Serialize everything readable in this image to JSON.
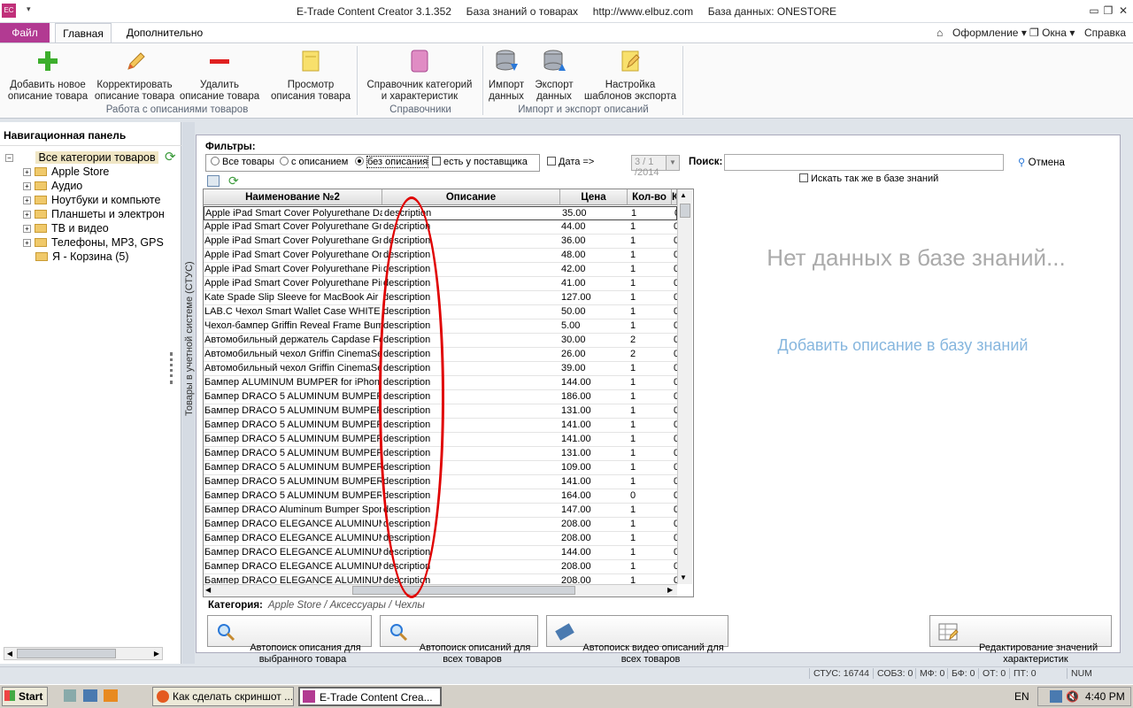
{
  "titlebar": {
    "title": "E-Trade Content Creator 3.1.352     База знаний о товарах     http://www.elbuz.com     База данных: ONESTORE",
    "app_icon": "EC"
  },
  "ribbon_tabs": {
    "file": "Файл",
    "home": "Главная",
    "extra": "Дополнительно",
    "right_menus": [
      "Оформление",
      "Окна",
      "Справка"
    ]
  },
  "ribbon": {
    "buttons": [
      {
        "label": "Добавить новое\nописание товара",
        "icon": "plus-icon"
      },
      {
        "label": "Корректировать\nописание товара",
        "icon": "pencil-icon"
      },
      {
        "label": "Удалить\nописание товара",
        "icon": "minus-icon"
      },
      {
        "label": "Просмотр\nописания товара",
        "icon": "note-icon"
      },
      {
        "label": "Справочник категорий\nи характеристик",
        "icon": "book-icon"
      },
      {
        "label": "Импорт\nданных",
        "icon": "db-import-icon"
      },
      {
        "label": "Экспорт\nданных",
        "icon": "db-export-icon"
      },
      {
        "label": "Настройка\nшаблонов экспорта",
        "icon": "template-icon"
      }
    ],
    "groups": [
      "Работа с описаниями товаров",
      "Справочники",
      "Импорт и экспорт описаний"
    ]
  },
  "nav": {
    "title": "Навигационная панель",
    "root": "Все категории товаров",
    "items": [
      "Apple Store",
      "Аудио",
      "Ноутбуки и компьюте",
      "Планшеты и электрон",
      "ТВ и видео",
      "Телефоны, MP3, GPS",
      "Я - Корзина (5)"
    ],
    "vertical_label": "Товары в учетной системе (СТУС)"
  },
  "filters": {
    "label": "Фильтры:",
    "radios": [
      "Все товары",
      "с описанием",
      "без описания"
    ],
    "selected": "без описания",
    "supplier_check": "есть у поставщика",
    "date_check": "Дата =>",
    "date_value": "3 / 1 /2014",
    "search_label": "Поиск:",
    "search_value": "",
    "cancel": "Отмена",
    "kb_search": "Искать так же в базе знаний"
  },
  "grid": {
    "columns": [
      "Наименование №2",
      "Описание",
      "Цена",
      "Кол-во",
      "К"
    ],
    "rows": [
      [
        "Apple iPad Smart Cover Polyurethane Dar",
        "description",
        "35.00",
        "1",
        "0"
      ],
      [
        "Apple iPad Smart Cover Polyurethane Gra",
        "description",
        "44.00",
        "1",
        "0"
      ],
      [
        "Apple iPad Smart Cover Polyurethane Gre",
        "description",
        "36.00",
        "1",
        "0"
      ],
      [
        "Apple iPad Smart Cover Polyurethane Ora",
        "description",
        "48.00",
        "1",
        "0"
      ],
      [
        "Apple iPad Smart Cover Polyurethane Pink",
        "description",
        "42.00",
        "1",
        "0"
      ],
      [
        "Apple iPad Smart Cover Polyurethane Pink",
        "description",
        "41.00",
        "1",
        "0"
      ],
      [
        "Kate Spade Slip Sleeve for MacBook Air 1",
        "description",
        "127.00",
        "1",
        "0"
      ],
      [
        "LAB.C Чехол Smart Wallet Case WHITE f",
        "description",
        "50.00",
        "1",
        "0"
      ],
      [
        "Чехол-бампер Griffin Reveal Frame Bump",
        "description",
        "5.00",
        "1",
        "0"
      ],
      [
        "Автомобильный держатель Capdase Fo",
        "description",
        "30.00",
        "2",
        "0"
      ],
      [
        "Автомобильный чехол Griffin CinemaSe",
        "description",
        "26.00",
        "2",
        "0"
      ],
      [
        "Автомобильный чехол Griffin CinemaSe",
        "description",
        "39.00",
        "1",
        "0"
      ],
      [
        "Бампер ALUMINUM BUMPER for iPhone 5",
        "description",
        "144.00",
        "1",
        "0"
      ],
      [
        "Бампер DRACO 5 ALUMINUM BUMPER Lin",
        "description",
        "186.00",
        "1",
        "0"
      ],
      [
        "Бампер DRACO 5 ALUMINUM BUMPER for",
        "description",
        "131.00",
        "1",
        "0"
      ],
      [
        "Бампер DRACO 5 ALUMINUM BUMPER FA",
        "description",
        "141.00",
        "1",
        "0"
      ],
      [
        "Бампер DRACO 5 ALUMINUM BUMPER GA",
        "description",
        "141.00",
        "1",
        "0"
      ],
      [
        "Бампер DRACO 5 ALUMINUM BUMPER GA",
        "description",
        "131.00",
        "1",
        "0"
      ],
      [
        "Бампер DRACO 5 ALUMINUM BUMPER MI",
        "description",
        "109.00",
        "1",
        "0"
      ],
      [
        "Бампер DRACO 5 ALUMINUM BUMPER MI",
        "description",
        "141.00",
        "1",
        "0"
      ],
      [
        "Бампер DRACO 5 ALUMINUM BUMPER Lin",
        "description",
        "164.00",
        "0",
        "0"
      ],
      [
        "Бампер DRACO Aluminum Bumper Sports",
        "description",
        "147.00",
        "1",
        "0"
      ],
      [
        "Бампер DRACO ELEGANCE ALUMINUM BU",
        "description",
        "208.00",
        "1",
        "0"
      ],
      [
        "Бампер DRACO ELEGANCE ALUMINUM BU",
        "description",
        "208.00",
        "1",
        "0"
      ],
      [
        "Бампер DRACO ELEGANCE ALUMINUM BU",
        "description",
        "144.00",
        "1",
        "0"
      ],
      [
        "Бампер DRACO ELEGANCE ALUMINUM BU",
        "description",
        "208.00",
        "1",
        "0"
      ],
      [
        "Бампер DRACO ELEGANCE ALUMINUM BU",
        "description",
        "208.00",
        "1",
        "0"
      ]
    ]
  },
  "knowledge": {
    "no_data": "Нет данных в базе знаний...",
    "add_link": "Добавить описание в базу знаний"
  },
  "category": {
    "label": "Категория:",
    "value": "Apple Store / Аксессуары / Чехлы"
  },
  "bottom_buttons": {
    "auto_selected": "Автопоиск описания для\nвыбранного товара",
    "auto_all": "Автопоиск описаний для\nвсех товаров",
    "auto_video": "Автопоиск видео описаний для\nвсех товаров",
    "edit_values": "Редактирование значений\nхарактеристик"
  },
  "statusbar": [
    "СТУС: 16744",
    "СОБЗ: 0",
    "МФ: 0",
    "БФ: 0",
    "ОТ: 0",
    "ПТ: 0",
    "NUM"
  ],
  "taskbar": {
    "start": "Start",
    "tasks": [
      "Как сделать скриншот ...",
      "E-Trade Content Crea..."
    ],
    "lang": "EN",
    "clock": "4:40 PM"
  },
  "colors": {
    "accent": "#b23a92",
    "highlight": "#e00000",
    "link": "#86b6de"
  }
}
